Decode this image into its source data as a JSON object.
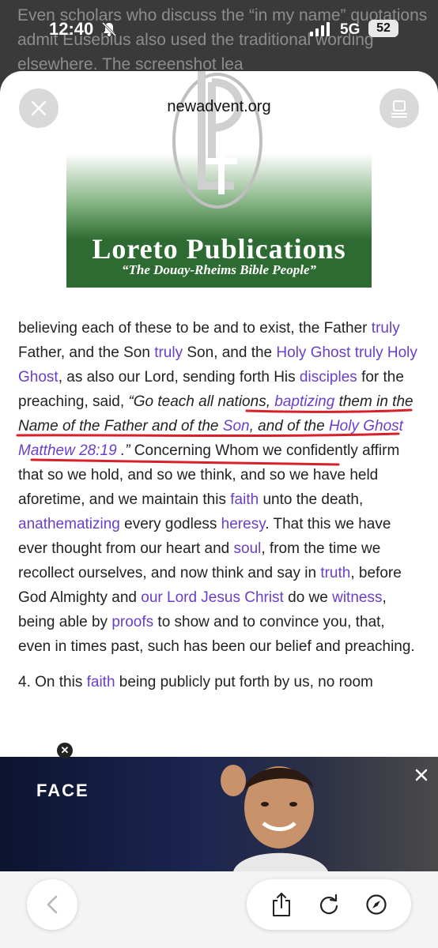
{
  "background_page": {
    "text": "Even scholars who discuss the “in my name” quotations admit Eusebius also used the traditional wording elsewhere. The screenshot lea"
  },
  "status_bar": {
    "time": "12:40",
    "network": "5G",
    "battery": "52"
  },
  "sheet": {
    "domain": "newadvent.org"
  },
  "banner": {
    "title": "Loreto Publications",
    "subtitle": "“The Douay-Rheims Bible People”"
  },
  "article": {
    "p1": {
      "t1": "believing each of these to be and to exist, the Father ",
      "l1": "truly",
      "t2": " Father, and the Son ",
      "l2": "truly",
      "t3": " Son, and the ",
      "l3": "Holy Ghost",
      "t4": " ",
      "l4": "truly Holy Ghost",
      "t5": ", as also our Lord, sending forth His ",
      "l5": "disciples",
      "t6": " for the preaching, said, ",
      "q1": "“Go teach all nations, ",
      "ql1": "baptizing",
      "q2": " them in the Name of the Father and of the ",
      "ql2": "Son",
      "q3": ", and of the ",
      "ql3": "Holy Ghost",
      "q4": " ",
      "ql4": "Matthew 28:19",
      "q5": " .”",
      "t7": " Concerning Whom we confidently affirm that so we hold, and so we think, and so we have held aforetime, and we maintain this ",
      "l6": "faith",
      "t8": " unto the death, ",
      "l7": "anathematizing",
      "t9": " every godless ",
      "l8": "heresy",
      "t10": ". That this we have ever thought from our heart and ",
      "l9": "soul",
      "t11": ", from the time we recollect ourselves, and now think and say in ",
      "l10": "truth",
      "t12": ", before God Almighty and ",
      "l11": "our Lord Jesus Christ",
      "t13": " do we ",
      "l12": "witness",
      "t14": ", being able by ",
      "l13": "proofs",
      "t15": " to show and to convince you, that, even in times past, such has been our belief and preaching."
    },
    "p2": {
      "t1": "4. On this ",
      "l1": "faith",
      "t2": " being publicly put forth by us, no room"
    }
  },
  "ad": {
    "title": "FACE",
    "choices_label": "✕"
  },
  "colors": {
    "link": "#6a3fc8",
    "underline": "#d8202a",
    "banner_green": "#2e6b32"
  },
  "icons": [
    "bell-slash-icon",
    "signal-icon",
    "close-icon",
    "reader-icon",
    "chevron-left-icon",
    "share-icon",
    "reload-icon",
    "compass-icon",
    "ad-close-icon"
  ]
}
